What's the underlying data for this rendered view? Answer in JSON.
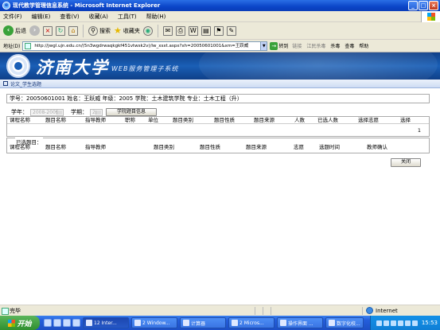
{
  "window": {
    "title": "现代教学管理信息系统 - Microsoft Internet Explorer",
    "min": "_",
    "max": "□",
    "close": "×"
  },
  "menu": [
    "文件(F)",
    "编辑(E)",
    "查看(V)",
    "收藏(A)",
    "工具(T)",
    "帮助(H)"
  ],
  "toolbar": {
    "back": "后退",
    "search": "搜索",
    "favorites": "收藏夹"
  },
  "address": {
    "label": "地址(D)",
    "url": "http://jwgl.ujn.edu.cn/(5n3wgdrwaqkgkf451vtwsk2v)/lw_xsxt.aspx?xh=20050601001&xm=王跃威",
    "go": "转到",
    "links": "链接",
    "jiangmin": "江民杀毒",
    "kill": "杀毒",
    "query": "查毒",
    "help": "帮助"
  },
  "banner": {
    "university": "济南大学",
    "system": "WEB服务管理子系统"
  },
  "breadcrumb": "论文_学生选题",
  "student": {
    "info": "学号：20050601001 姓名：王跃威 年级：2005 学院：土木建筑学院 专业：土木工程（升）"
  },
  "filter": {
    "year_label": "学年：",
    "year_value": "2008-2009",
    "term_label": "学期：",
    "term_value": "2",
    "info_button": "学院题目信息"
  },
  "topics_table": {
    "columns": [
      "课程名称",
      "题目名称",
      "指导教师",
      "职称",
      "单位",
      "题目类别",
      "题目性质",
      "题目来源",
      "人数",
      "已选人数",
      "选择志愿",
      "选择"
    ],
    "row_count": "1"
  },
  "selected": {
    "legend": "已选题目：",
    "columns": [
      "课程名称",
      "题目名称",
      "指导教师",
      "题目类别",
      "题目性质",
      "题目来源",
      "志愿",
      "选题时间",
      "教师确认"
    ]
  },
  "close_button": "关闭",
  "status": {
    "done": "完毕",
    "zone": "Internet"
  },
  "taskbar": {
    "start": "开始",
    "tasks": [
      "12 Inter...",
      "2 Window...",
      "计算器",
      "2 Micros...",
      "操作界面 ...",
      "数字化校..."
    ],
    "clock": "15:53"
  }
}
